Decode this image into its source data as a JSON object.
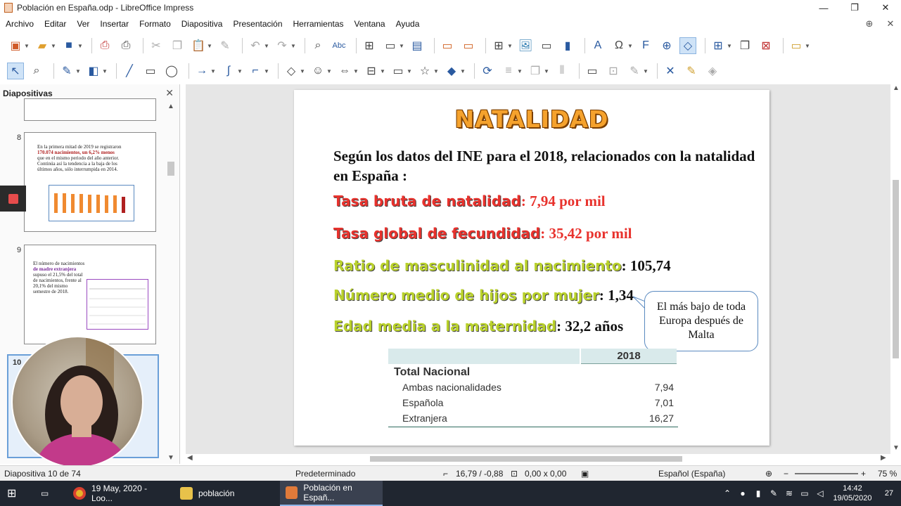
{
  "window": {
    "title": "Población en España.odp - LibreOffice Impress",
    "minimize": "—",
    "restore": "❐",
    "close": "✕"
  },
  "menu": [
    "Archivo",
    "Editar",
    "Ver",
    "Insertar",
    "Formato",
    "Diapositiva",
    "Presentación",
    "Herramientas",
    "Ventana",
    "Ayuda"
  ],
  "slides_panel": {
    "title": "Diapositivas",
    "close": "✕",
    "thumb_numbers": [
      "8",
      "9",
      "10"
    ],
    "thumb8_lines": [
      "En la primera mitad de 2019 se registraron",
      "170.074 nacimientos, un 6,2% menos",
      "que en el mismo periodo del año anterior.",
      "Continúa así la tendencia a la baja de los",
      "últimos años, sólo interrumpida en 2014."
    ],
    "thumb9_lines": [
      "El número de nacimientos",
      "de madre extranjera",
      "supuso el 21,5% del total",
      "de nacimientos, frente al",
      "20,1% del mismo",
      "semestre de 2018."
    ]
  },
  "slide": {
    "title": "NATALIDAD",
    "intro": "Según los datos del INE para el 2018, relacionados con la natalidad en España :",
    "stats": [
      {
        "label": "Tasa bruta de natalidad",
        "value": ": 7,94 por mil"
      },
      {
        "label": "Tasa global de fecundidad",
        "value": ": 35,42 por mil"
      },
      {
        "label": "Ratio de masculinidad al nacimiento",
        "value": ": 105,74"
      },
      {
        "label": "Número medio de hijos por mujer",
        "value": ": 1,34"
      },
      {
        "label": "Edad media a la maternidad",
        "value": ": 32,2 años"
      }
    ],
    "callout": "El más bajo de toda Europa después de Malta",
    "table": {
      "year": "2018",
      "total_label": "Total Nacional",
      "rows": [
        {
          "name": "Ambas nacionalidades",
          "value": "7,94"
        },
        {
          "name": "Española",
          "value": "7,01"
        },
        {
          "name": "Extranjera",
          "value": "16,27"
        }
      ]
    }
  },
  "status": {
    "slide_pos": "Diapositiva 10 de 74",
    "layout": "Predeterminado",
    "position": "16,79 / -0,88",
    "size": "0,00 x 0,00",
    "language": "Español (España)",
    "zoom": "75 %"
  },
  "taskbar": {
    "chrome_label": "19 May, 2020 - Loo...",
    "folder_label": "población",
    "impress_label": "Población en Españ...",
    "time": "14:42",
    "date": "19/05/2020",
    "notifications": "27"
  },
  "colors": {
    "title_orange": "#f5a22d",
    "stat_red": "#e8322d",
    "stat_green": "#b9d12b",
    "taskbar": "#202630"
  }
}
